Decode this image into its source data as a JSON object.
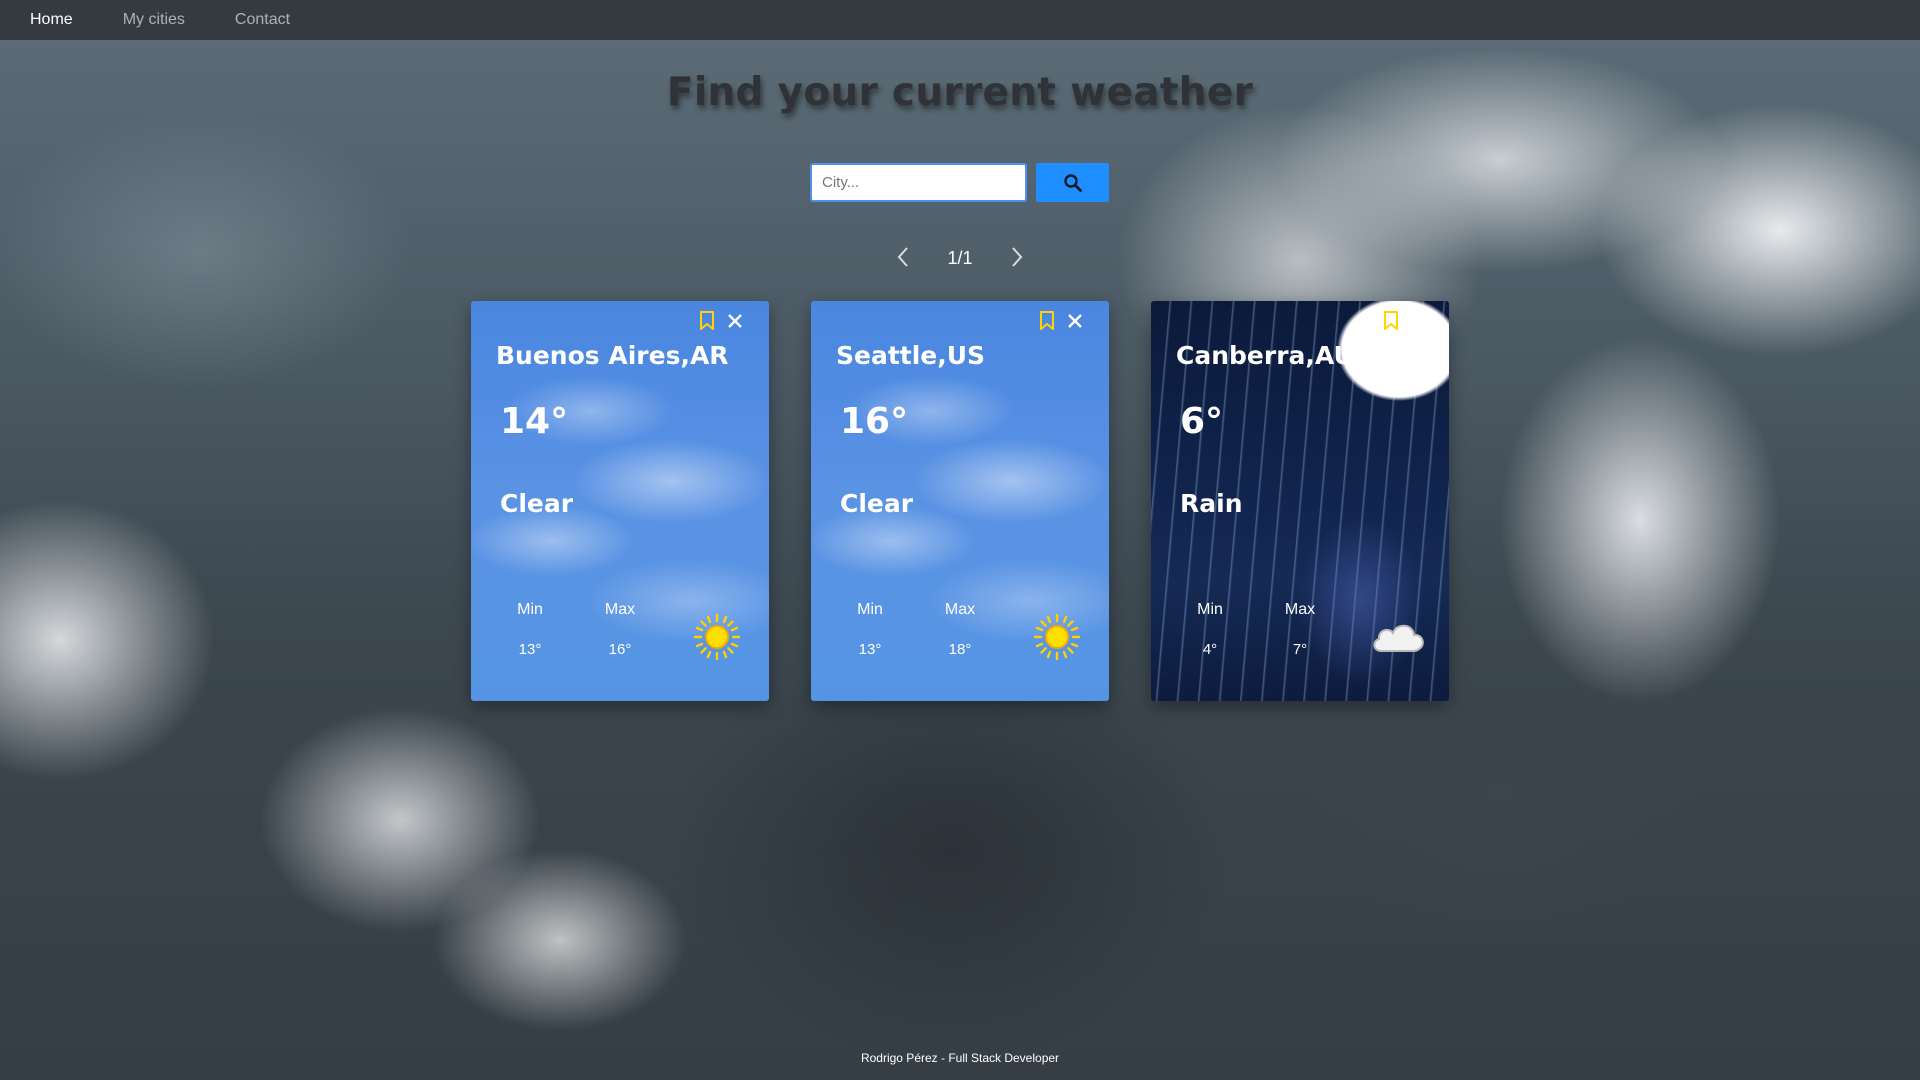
{
  "nav": {
    "items": [
      {
        "label": "Home"
      },
      {
        "label": "My cities"
      },
      {
        "label": "Contact"
      }
    ]
  },
  "header": {
    "title": "Find your current weather"
  },
  "search": {
    "placeholder": "City..."
  },
  "pagination": {
    "indicator": "1/1"
  },
  "cards": [
    {
      "city": "Buenos Aires,AR",
      "temp": "14°",
      "description": "Clear",
      "min_label": "Min",
      "min_value": "13°",
      "max_label": "Max",
      "max_value": "16°",
      "icon": "sun-icon",
      "background": "sky"
    },
    {
      "city": "Seattle,US",
      "temp": "16°",
      "description": "Clear",
      "min_label": "Min",
      "min_value": "13°",
      "max_label": "Max",
      "max_value": "18°",
      "icon": "sun-icon",
      "background": "sky"
    },
    {
      "city": "Canberra,AU",
      "temp": "6°",
      "description": "Rain",
      "min_label": "Min",
      "min_value": "4°",
      "max_label": "Max",
      "max_value": "7°",
      "icon": "cloud-icon",
      "background": "rain"
    }
  ],
  "footer": {
    "text": "Rodrigo Pérez - Full Stack Developer"
  },
  "colors": {
    "navbar": "#343a40",
    "search_button": "#1f8fff",
    "bookmark": "#ffd400",
    "sun": "#ffd000"
  }
}
